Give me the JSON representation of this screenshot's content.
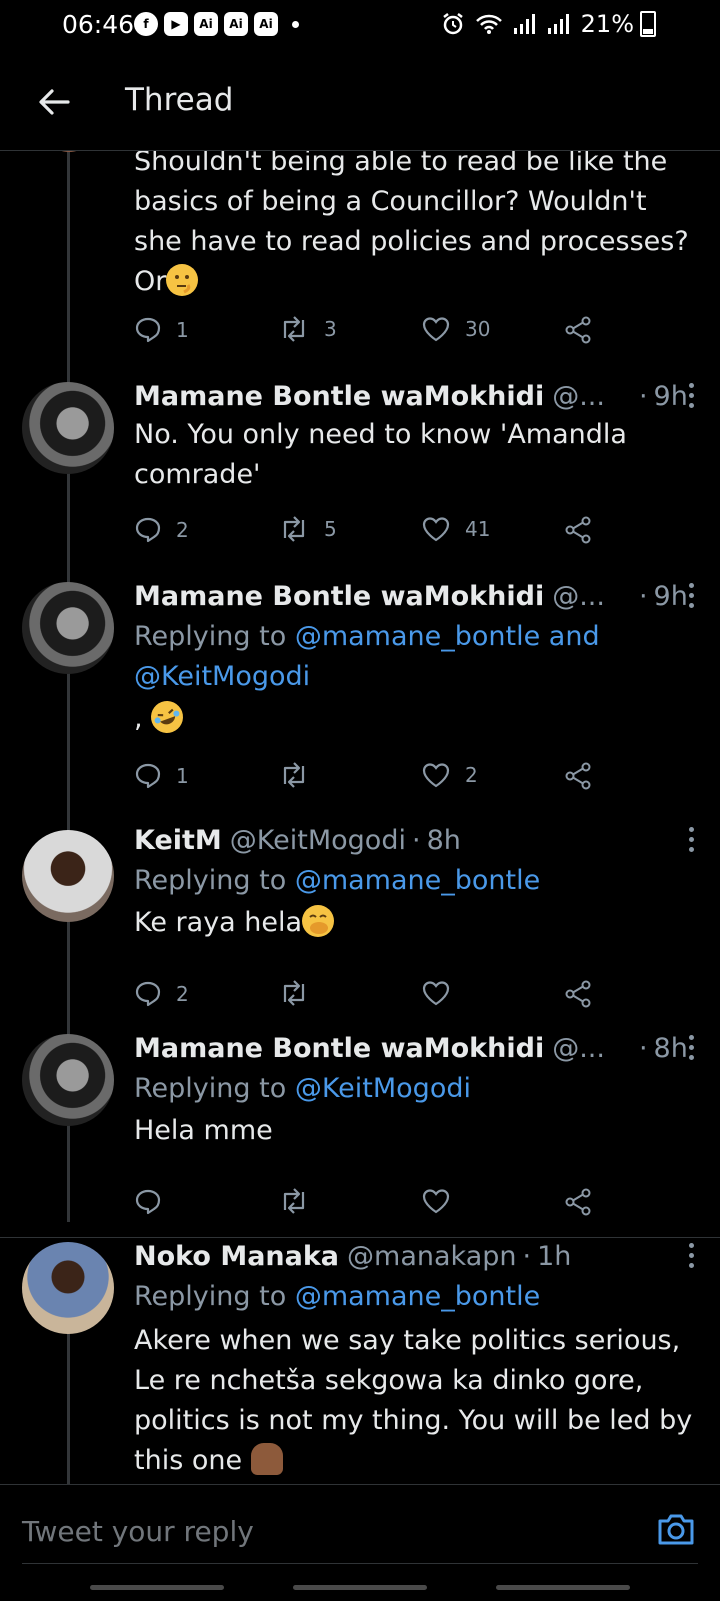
{
  "status_bar": {
    "time": "06:46",
    "battery": "21%"
  },
  "app_bar": {
    "title": "Thread"
  },
  "tweets": [
    {
      "text": "Shouldn't being able to read be like the basics of being a Councillor? Wouldn't she have to read policies and processes? Or",
      "emoji": "thinking-face",
      "replies": "1",
      "retweets": "3",
      "likes": "30"
    },
    {
      "name": "Mamane Bontle waMokhidi",
      "handle": "@...",
      "time": "9h",
      "text": "No. You only need to know 'Amandla comrade'",
      "replies": "2",
      "retweets": "5",
      "likes": "41"
    },
    {
      "name": "Mamane Bontle waMokhidi",
      "handle": "@...",
      "time": "9h",
      "replying_prefix": "Replying to",
      "replying_to": "@mamane_bontle and @KeitMogodi",
      "text": ",",
      "emoji": "rolling-on-floor-laughing",
      "replies": "1",
      "retweets": "",
      "likes": "2"
    },
    {
      "name": "KeitM",
      "handle": "@KeitMogodi",
      "time": "8h",
      "replying_prefix": "Replying to",
      "replying_to": "@mamane_bontle",
      "text": "Ke raya hela",
      "emoji": "face-with-hand-over-mouth",
      "replies": "2",
      "retweets": "",
      "likes": ""
    },
    {
      "name": "Mamane Bontle waMokhidi",
      "handle": "@...",
      "time": "8h",
      "replying_prefix": "Replying to",
      "replying_to": "@KeitMogodi",
      "text": "Hela mme",
      "replies": "",
      "retweets": "",
      "likes": ""
    },
    {
      "name": "Noko Manaka",
      "handle": "@manakapn",
      "time": "1h",
      "replying_prefix": "Replying to",
      "replying_to": "@mamane_bontle",
      "text": "Akere when we say take politics serious, Le re nchetša sekgowa ka dinko gore, politics is not my thing. You will be led by this one",
      "emoji": "pinching-hand"
    }
  ],
  "composer": {
    "placeholder": "Tweet your reply"
  },
  "colors": {
    "background": "#000000",
    "text": "#e7e9ea",
    "muted": "#8b98a5",
    "link": "#4a99e9"
  }
}
